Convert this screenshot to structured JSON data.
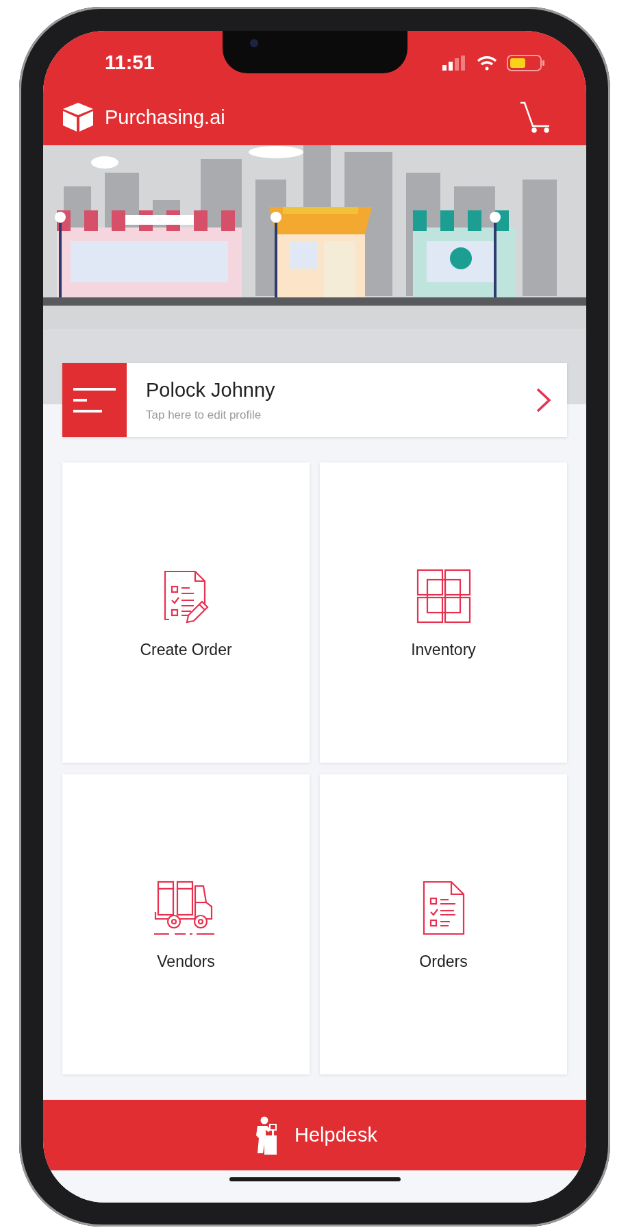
{
  "status_bar": {
    "time": "11:51"
  },
  "header": {
    "title": "Purchasing.ai"
  },
  "profile": {
    "name": "Polock Johnny",
    "hint": "Tap here to edit profile"
  },
  "tiles": [
    {
      "label": "Create Order",
      "kind": "create-order"
    },
    {
      "label": "Inventory",
      "kind": "inventory"
    },
    {
      "label": "Vendors",
      "kind": "vendors"
    },
    {
      "label": "Orders",
      "kind": "orders"
    }
  ],
  "footer": {
    "label": "Helpdesk"
  }
}
